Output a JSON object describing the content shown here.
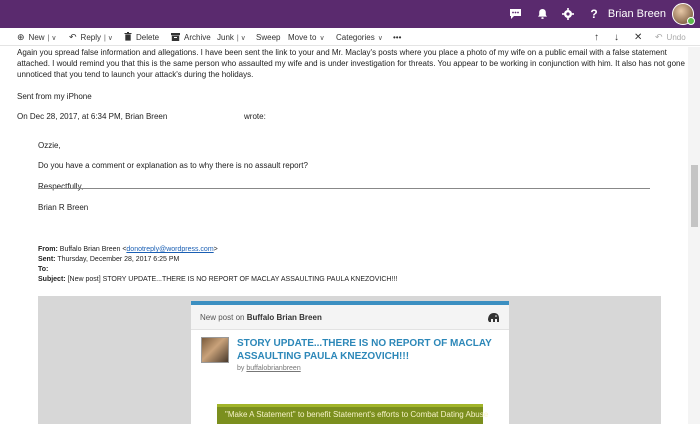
{
  "topbar": {
    "user_name": "Brian Breen",
    "icons": [
      "skype-icon",
      "bell-icon",
      "gear-icon",
      "help-icon"
    ],
    "accent": "#5a2a6e"
  },
  "toolbar": {
    "new_label": "New",
    "reply_label": "Reply",
    "delete_label": "Delete",
    "archive_label": "Archive",
    "junk_label": "Junk",
    "sweep_label": "Sweep",
    "move_label": "Move to",
    "categories_label": "Categories",
    "more_label": "•••",
    "undo_label": "Undo"
  },
  "message": {
    "paragraph1_line1": "Again you spread false information and allegations. I have been sent the link to your and Mr. Maclay's posts where you place a photo of my wife on a public email with a false statement",
    "paragraph1_line2": "attached. I would remind you that this is the same person who assaulted my wife and is under investigation for threats. You appear to be working in conjunction with him. It also has not gone",
    "paragraph1_line3": "unnoticed that you tend to launch your attack's during the holidays.",
    "signature": "Sent from my iPhone",
    "quote_intro": "On Dec 28, 2017, at 6:34 PM, Brian Breen",
    "quote_wrote": "wrote:",
    "q_greeting": "Ozzie,",
    "q_body": "Do you have a comment or explanation as to why there is no assault report?",
    "q_closing": "Respectfully,",
    "q_name": "Brian R Breen"
  },
  "forward": {
    "from_label": "From:",
    "from_value": "Buffalo Brian Breen <",
    "from_email": "donotreply@wordpress.com",
    "from_end": ">",
    "sent_label": "Sent:",
    "sent_value": "Thursday, December 28, 2017 6:25 PM",
    "to_label": "To:",
    "subject_label": "Subject:",
    "subject_value": "[New post] STORY UPDATE...THERE IS NO REPORT OF MACLAY ASSAULTING PAULA KNEZOVICH!!!"
  },
  "newsletter": {
    "new_post_on": "New post on",
    "blog_name": "Buffalo Brian Breen",
    "post_title": "STORY UPDATE...THERE IS NO REPORT OF MACLAY ASSAULTING PAULA KNEZOVICH!!!",
    "by": "by",
    "author": "buffalobrianbreen",
    "banner_text": "\"Make A Statement\" to benefit Statement's efforts to Combat Dating Abuse",
    "title_color": "#2c87b8"
  }
}
